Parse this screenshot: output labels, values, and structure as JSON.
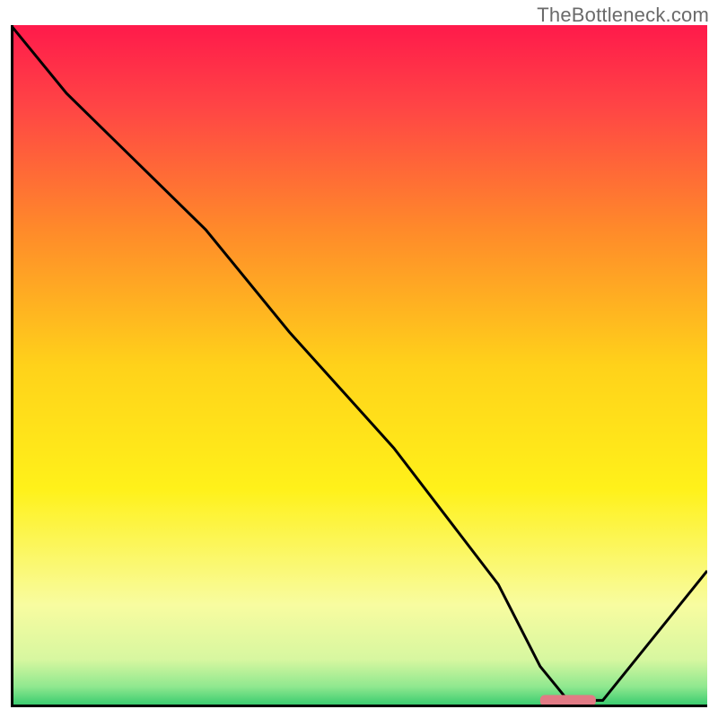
{
  "watermark": "TheBottleneck.com",
  "chart_data": {
    "type": "line",
    "title": "",
    "xlabel": "",
    "ylabel": "",
    "xlim": [
      0,
      100
    ],
    "ylim": [
      0,
      100
    ],
    "grid": false,
    "legend": false,
    "series": [
      {
        "name": "curve",
        "color": "#000000",
        "x": [
          0,
          8,
          20,
          28,
          40,
          55,
          70,
          76,
          80,
          85,
          100
        ],
        "y": [
          100,
          90,
          78,
          70,
          55,
          38,
          18,
          6,
          1,
          1,
          20
        ]
      }
    ],
    "marker": {
      "name": "optimal-marker",
      "color": "#e27b85",
      "x_start": 76,
      "x_end": 84,
      "y": 1
    },
    "background_gradient": {
      "stops": [
        {
          "offset": 0.0,
          "color": "#ff1a4b"
        },
        {
          "offset": 0.12,
          "color": "#ff4545"
        },
        {
          "offset": 0.3,
          "color": "#ff8a2a"
        },
        {
          "offset": 0.5,
          "color": "#ffd21a"
        },
        {
          "offset": 0.68,
          "color": "#fff11a"
        },
        {
          "offset": 0.85,
          "color": "#f8fca0"
        },
        {
          "offset": 0.93,
          "color": "#d7f7a0"
        },
        {
          "offset": 0.97,
          "color": "#8fe88f"
        },
        {
          "offset": 1.0,
          "color": "#2fc86b"
        }
      ]
    }
  }
}
